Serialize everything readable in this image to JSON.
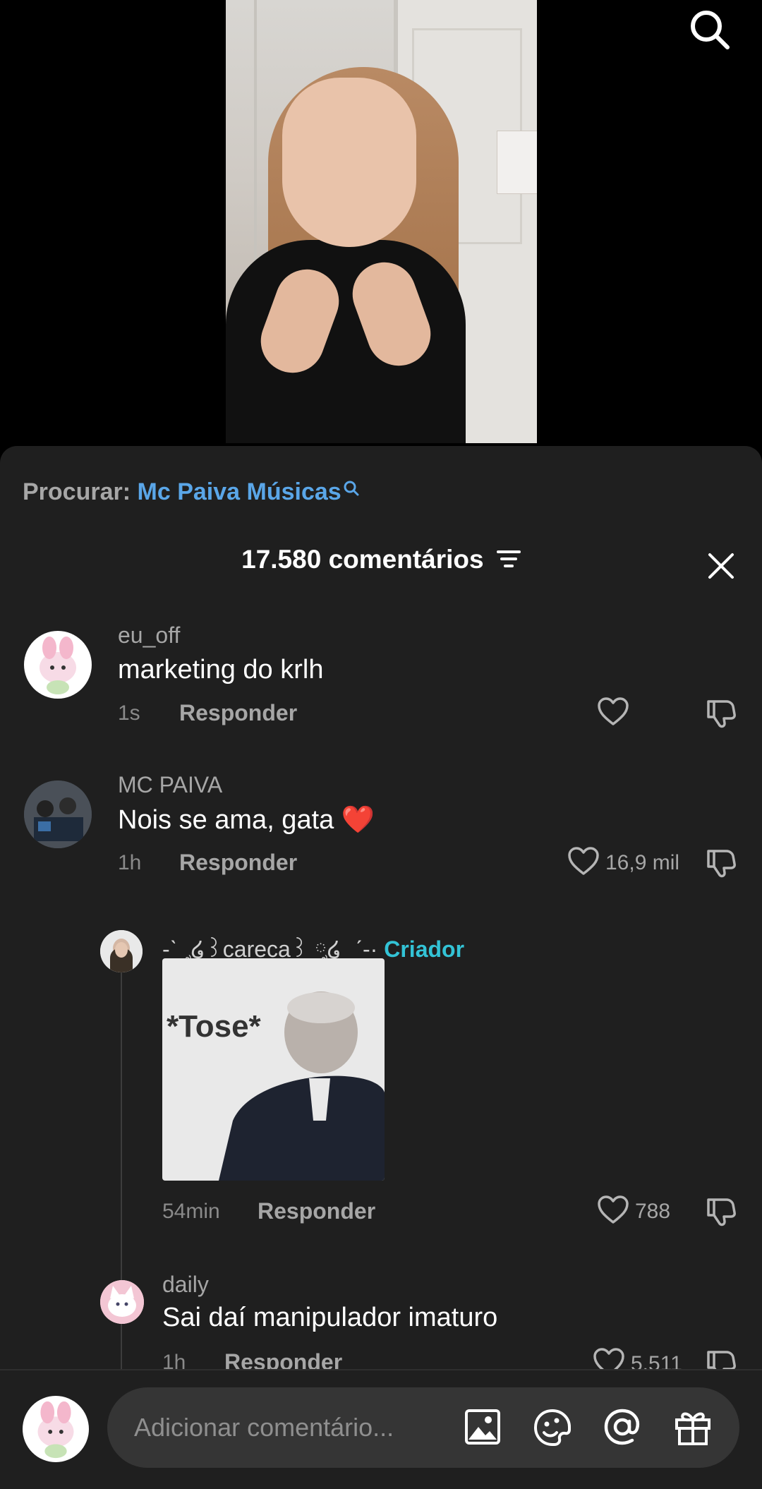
{
  "search": {
    "prefix": "Procurar:",
    "term": "Mc Paiva Músicas"
  },
  "comments_header": {
    "count_label": "17.580 comentários"
  },
  "comments": [
    {
      "username": "eu_off",
      "text": "marketing do krlh",
      "time": "1s",
      "reply_label": "Responder",
      "likes": ""
    },
    {
      "username": "MC PAIVA",
      "text": "Nois se ama, gata",
      "emoji": "❤️",
      "time": "1h",
      "reply_label": "Responder",
      "likes": "16,9 mil"
    }
  ],
  "replies": [
    {
      "username": "-ˋˏ ༘໒꒱careca꒱ ༘໒ ˎˊ-·",
      "badge": "Criador",
      "image_text": "*Tose*",
      "time": "54min",
      "reply_label": "Responder",
      "likes": "788"
    },
    {
      "username": "daily",
      "text": "Sai daí manipulador imaturo",
      "time": "1h",
      "reply_label": "Responder",
      "likes": "5.511"
    }
  ],
  "composer": {
    "placeholder": "Adicionar comentário..."
  },
  "colors": {
    "sheet_bg": "#1f1f1f",
    "link_blue": "#5aa6e8",
    "creator_teal": "#33c3d6",
    "heart_red": "#ff3b5c"
  }
}
